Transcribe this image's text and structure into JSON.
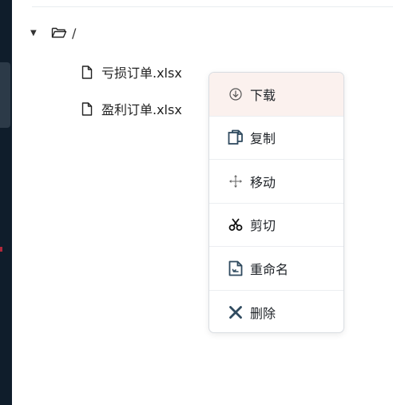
{
  "tree": {
    "root_label": "/",
    "files": [
      {
        "name": "亏损订单.xlsx"
      },
      {
        "name": "盈利订单.xlsx"
      }
    ]
  },
  "context_menu": {
    "items": [
      {
        "label": "下载",
        "icon": "download-circle-icon",
        "active": true
      },
      {
        "label": "复制",
        "icon": "copy-icon"
      },
      {
        "label": "移动",
        "icon": "move-arrows-icon"
      },
      {
        "label": "剪切",
        "icon": "scissors-icon"
      },
      {
        "label": "重命名",
        "icon": "rename-icon"
      },
      {
        "label": "删除",
        "icon": "delete-x-icon"
      }
    ]
  },
  "colors": {
    "sidebar": "#0f1d2b",
    "active_item_bg": "#fbf1ee",
    "icon_blue": "#2f4a5f"
  }
}
